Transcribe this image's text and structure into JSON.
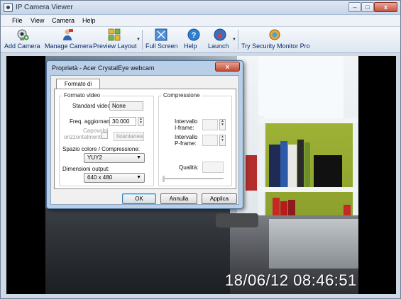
{
  "window": {
    "title": "IP Camera Viewer",
    "controls": {
      "minimize": "–",
      "maximize": "□",
      "close": "x"
    }
  },
  "menu": [
    "File",
    "View",
    "Camera",
    "Help"
  ],
  "toolbar": {
    "add_camera": "Add Camera",
    "manage_camera": "Manage Camera",
    "preview_layout": "Preview Layout",
    "full_screen": "Full Screen",
    "help": "Help",
    "launch": "Launch",
    "try_security": "Try Security Monitor Pro"
  },
  "video": {
    "timestamp": "18/06/12 08:46:51"
  },
  "dialog": {
    "title": "Proprietà - Acer CrystalEye webcam",
    "close": "x",
    "tab": "Formato di flusso",
    "video_format": {
      "group_label": "Formato video",
      "standard_label": "Standard video:",
      "standard_value": "None",
      "rate_label": "Freq. aggiornam.:",
      "rate_value": "30.000",
      "flip_label_1": "Capovolgi",
      "flip_label_2": "orizzontalmente:",
      "snapshot_label": "Istantanea",
      "color_label": "Spazio colore / Compressione:",
      "color_value": "YUY2",
      "size_label": "Dimensioni output:",
      "size_value": "640 x 480"
    },
    "compression": {
      "group_label": "Compressione",
      "iframe_label_1": "Intervallo",
      "iframe_label_2": "I-frame:",
      "pframe_label_1": "Intervallo",
      "pframe_label_2": "P-frame:",
      "quality_label": "Qualità:"
    },
    "buttons": {
      "ok": "OK",
      "cancel": "Annulla",
      "apply": "Applica"
    }
  },
  "colors": {
    "toolbar_text": "#0b2a6b",
    "dialog_frame": "#b9cfe8",
    "close_red": "#c24a33"
  }
}
